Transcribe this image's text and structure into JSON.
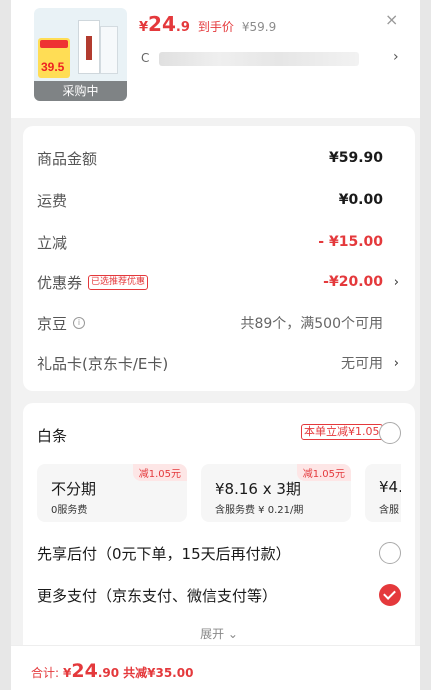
{
  "product": {
    "thumb_promo": "39.5",
    "thumb_label": "采购中",
    "price_currency": "¥",
    "price_int": "24",
    "price_dec": ".9",
    "price_tag": "到手价",
    "price_original": "¥59.9",
    "title": "C",
    "close_symbol": "×",
    "arrow_symbol": "›"
  },
  "fees": {
    "rows": [
      {
        "label": "商品金额",
        "value": "¥59.90"
      },
      {
        "label": "运费",
        "value": "¥0.00"
      },
      {
        "label": "立减",
        "value": "- ¥15.00"
      },
      {
        "label": "优惠券",
        "badge": "已选推荐优惠",
        "value": "-¥20.00"
      },
      {
        "label": "京豆",
        "info": "i",
        "value": "共89个，满500个可用"
      },
      {
        "label": "礼品卡(京东卡/E卡)",
        "value": "无可用"
      }
    ],
    "chevron": "›"
  },
  "payment": {
    "baitiao_title": "白条",
    "baitiao_discount": "本单立减¥1.05",
    "plans": [
      {
        "title": "不分期",
        "sub": "0服务费",
        "badge": "减1.05元"
      },
      {
        "title": "¥8.16 x 3期",
        "sub": "含服务费 ¥ 0.21/期",
        "badge": "减1.05元"
      },
      {
        "title": "¥4.",
        "sub": "含服"
      }
    ],
    "option_later": "先享后付（0元下单，15天后再付款）",
    "option_more": "更多支付（京东支付、微信支付等）",
    "expand_label": "展开 ⌄"
  },
  "footer": {
    "label": "合计:",
    "currency": "¥",
    "int": "24",
    "dec": ".90",
    "saved": "共减¥35.00"
  },
  "colors": {
    "accent": "#e4393c",
    "background": "#f2f2f2"
  }
}
